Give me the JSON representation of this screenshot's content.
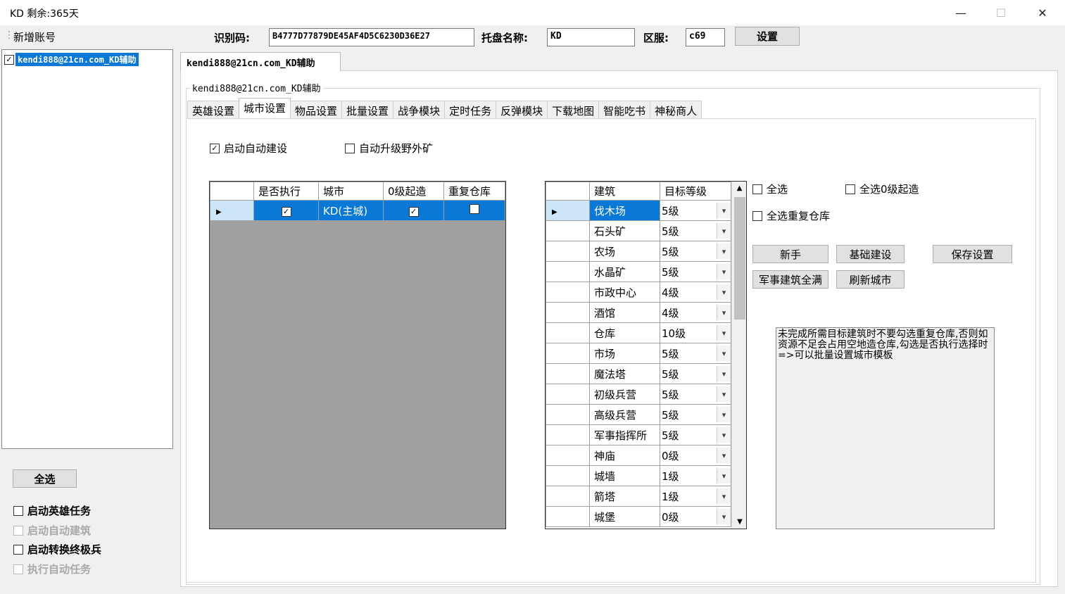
{
  "window": {
    "title": "KD 剩余:365天",
    "minimize": "—",
    "maximize": "☐",
    "close": "✕"
  },
  "toolbar": {
    "add_account": "新增账号",
    "id_label": "识别码:",
    "id_value": "B4777D77879DE45AF4D5C6230D36E27",
    "hosting_label": "托盘名称:",
    "hosting_value": "KD",
    "server_label": "区服:",
    "server_value": "c69",
    "set_button": "设置"
  },
  "accounts": [
    {
      "label": "kendi888@21cn.com_KD辅助",
      "checked": true
    }
  ],
  "left_bottom": {
    "select_all": "全选",
    "options": [
      {
        "label": "启动英雄任务",
        "checked": false,
        "disabled": false
      },
      {
        "label": "启动自动建筑",
        "checked": false,
        "disabled": true
      },
      {
        "label": "启动转换终极兵",
        "checked": false,
        "disabled": false
      },
      {
        "label": "执行自动任务",
        "checked": false,
        "disabled": true
      }
    ]
  },
  "account_tab": "kendi888@21cn.com_KD辅助",
  "group_title": "kendi888@21cn.com_KD辅助",
  "tabs": [
    "英雄设置",
    "城市设置",
    "物品设置",
    "批量设置",
    "战争模块",
    "定时任务",
    "反弹模块",
    "下载地图",
    "智能吃书",
    "神秘商人"
  ],
  "active_tab": 1,
  "city_options": {
    "auto_build": "启动自动建设",
    "auto_build_checked": true,
    "upgrade_mine": "自动升级野外矿",
    "upgrade_mine_checked": false
  },
  "city_table": {
    "headers": [
      "是否执行",
      "城市",
      "0级起造",
      "重复仓库"
    ],
    "rows": [
      {
        "execute": true,
        "city": "KD(主城)",
        "zero_start": true,
        "repeat_warehouse": false
      }
    ]
  },
  "building_table": {
    "headers": [
      "建筑",
      "目标等级"
    ],
    "rows": [
      {
        "name": "伐木场",
        "level": "5级"
      },
      {
        "name": "石头矿",
        "level": "5级"
      },
      {
        "name": "农场",
        "level": "5级"
      },
      {
        "name": "水晶矿",
        "level": "5级"
      },
      {
        "name": "市政中心",
        "level": "4级"
      },
      {
        "name": "酒馆",
        "level": "4级"
      },
      {
        "name": "仓库",
        "level": "10级"
      },
      {
        "name": "市场",
        "level": "5级"
      },
      {
        "name": "魔法塔",
        "level": "5级"
      },
      {
        "name": "初级兵营",
        "level": "5级"
      },
      {
        "name": "高级兵营",
        "level": "5级"
      },
      {
        "name": "军事指挥所",
        "level": "5级"
      },
      {
        "name": "神庙",
        "level": "0级"
      },
      {
        "name": "城墙",
        "level": "1级"
      },
      {
        "name": "箭塔",
        "level": "1级"
      },
      {
        "name": "城堡",
        "level": "0级"
      }
    ]
  },
  "right_panel": {
    "select_all": "全选",
    "select_all_zero": "全选0级起造",
    "select_all_repeat": "全选重复仓库",
    "btn_newbie": "新手",
    "btn_basic": "基础建设",
    "btn_save": "保存设置",
    "btn_military": "军事建筑全满",
    "btn_refresh": "刷新城市",
    "note": "未完成所需目标建筑时不要勾选重复仓库,否则如资源不足会占用空地造仓库,勾选是否执行选择时=>可以批量设置城市模板"
  }
}
